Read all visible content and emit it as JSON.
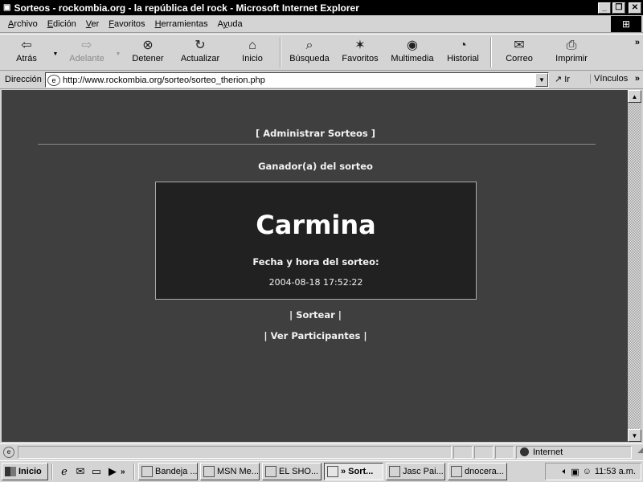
{
  "window": {
    "title": "Sorteos - rockombia.org - la república del rock - Microsoft Internet Explorer",
    "minimize_icon": "minimize-icon",
    "maximize_icon": "maximize-icon",
    "close_icon": "close-icon"
  },
  "menu": {
    "items": [
      {
        "u": "A",
        "rest": "rchivo"
      },
      {
        "u": "E",
        "rest": "dición"
      },
      {
        "u": "V",
        "rest": "er"
      },
      {
        "u": "F",
        "rest": "avoritos"
      },
      {
        "u": "H",
        "rest": "erramientas"
      },
      {
        "u": "A",
        "rest": "y",
        "after": "uda"
      }
    ]
  },
  "toolbar": {
    "back": "Atrás",
    "forward": "Adelante",
    "stop": "Detener",
    "refresh": "Actualizar",
    "home": "Inicio",
    "search": "Búsqueda",
    "favorites": "Favoritos",
    "media": "Multimedia",
    "history": "Historial",
    "mail": "Correo",
    "print": "Imprimir",
    "more": "»"
  },
  "address": {
    "label": "Dirección",
    "url": "http://www.rockombia.org/sorteo/sorteo_therion.php",
    "go": "Ir",
    "links": "Vínculos",
    "more": "»"
  },
  "page": {
    "admin_link": "[ Administrar Sorteos ]",
    "winner_heading": "Ganador(a) del sorteo",
    "winner_name": "Carmina",
    "draw_label": "Fecha y hora del sorteo:",
    "draw_datetime": "2004-08-18 17:52:22",
    "sortear_link": "| Sortear |",
    "participants_link": "| Ver Participantes |"
  },
  "status": {
    "text": "",
    "zone": "Internet"
  },
  "taskbar": {
    "start": "Inicio",
    "more": "»",
    "tasks": [
      {
        "label": "Bandeja ...",
        "width": 74
      },
      {
        "label": "MSN Me...",
        "width": 74
      },
      {
        "label": "EL SHO...",
        "width": 74
      },
      {
        "label": "» Sort...",
        "width": 74,
        "active": true
      },
      {
        "label": "Jasc Pai...",
        "width": 74
      },
      {
        "label": "dnocera...",
        "width": 74
      }
    ],
    "clock": "11:53 a.m."
  }
}
